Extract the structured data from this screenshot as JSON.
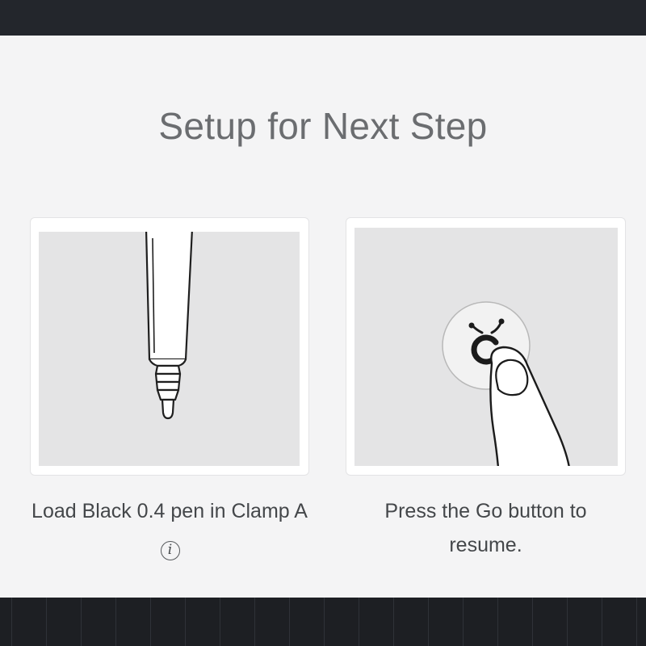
{
  "dialog": {
    "title": "Setup for Next Step"
  },
  "steps": [
    {
      "illustration": "pen-tip-illustration",
      "caption": "Load Black 0.4 pen in Clamp A",
      "info_icon": "info-icon",
      "info_glyph": "i"
    },
    {
      "illustration": "go-button-press-illustration",
      "caption": "Press the Go button to resume."
    }
  ],
  "colors": {
    "dialog_bg": "#f4f4f5",
    "illustration_bg": "#e4e4e5",
    "title_text": "#6b6d70",
    "caption_text": "#44474a",
    "app_chrome": "#22252b"
  }
}
